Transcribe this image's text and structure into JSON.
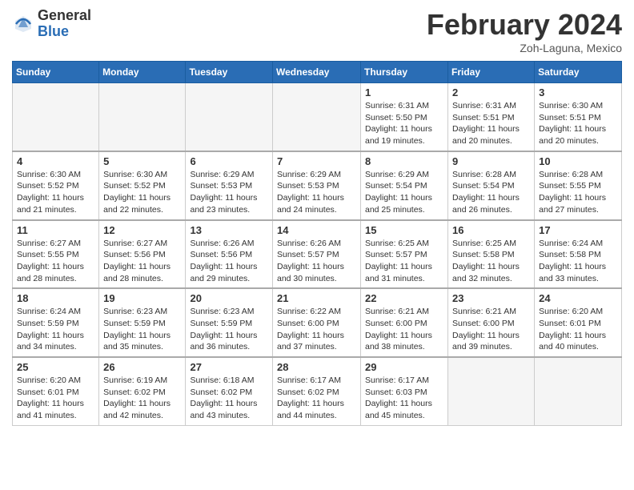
{
  "header": {
    "logo_general": "General",
    "logo_blue": "Blue",
    "month_title": "February 2024",
    "location": "Zoh-Laguna, Mexico"
  },
  "weekdays": [
    "Sunday",
    "Monday",
    "Tuesday",
    "Wednesday",
    "Thursday",
    "Friday",
    "Saturday"
  ],
  "weeks": [
    [
      {
        "day": "",
        "info": ""
      },
      {
        "day": "",
        "info": ""
      },
      {
        "day": "",
        "info": ""
      },
      {
        "day": "",
        "info": ""
      },
      {
        "day": "1",
        "info": "Sunrise: 6:31 AM\nSunset: 5:50 PM\nDaylight: 11 hours and 19 minutes."
      },
      {
        "day": "2",
        "info": "Sunrise: 6:31 AM\nSunset: 5:51 PM\nDaylight: 11 hours and 20 minutes."
      },
      {
        "day": "3",
        "info": "Sunrise: 6:30 AM\nSunset: 5:51 PM\nDaylight: 11 hours and 20 minutes."
      }
    ],
    [
      {
        "day": "4",
        "info": "Sunrise: 6:30 AM\nSunset: 5:52 PM\nDaylight: 11 hours and 21 minutes."
      },
      {
        "day": "5",
        "info": "Sunrise: 6:30 AM\nSunset: 5:52 PM\nDaylight: 11 hours and 22 minutes."
      },
      {
        "day": "6",
        "info": "Sunrise: 6:29 AM\nSunset: 5:53 PM\nDaylight: 11 hours and 23 minutes."
      },
      {
        "day": "7",
        "info": "Sunrise: 6:29 AM\nSunset: 5:53 PM\nDaylight: 11 hours and 24 minutes."
      },
      {
        "day": "8",
        "info": "Sunrise: 6:29 AM\nSunset: 5:54 PM\nDaylight: 11 hours and 25 minutes."
      },
      {
        "day": "9",
        "info": "Sunrise: 6:28 AM\nSunset: 5:54 PM\nDaylight: 11 hours and 26 minutes."
      },
      {
        "day": "10",
        "info": "Sunrise: 6:28 AM\nSunset: 5:55 PM\nDaylight: 11 hours and 27 minutes."
      }
    ],
    [
      {
        "day": "11",
        "info": "Sunrise: 6:27 AM\nSunset: 5:55 PM\nDaylight: 11 hours and 28 minutes."
      },
      {
        "day": "12",
        "info": "Sunrise: 6:27 AM\nSunset: 5:56 PM\nDaylight: 11 hours and 28 minutes."
      },
      {
        "day": "13",
        "info": "Sunrise: 6:26 AM\nSunset: 5:56 PM\nDaylight: 11 hours and 29 minutes."
      },
      {
        "day": "14",
        "info": "Sunrise: 6:26 AM\nSunset: 5:57 PM\nDaylight: 11 hours and 30 minutes."
      },
      {
        "day": "15",
        "info": "Sunrise: 6:25 AM\nSunset: 5:57 PM\nDaylight: 11 hours and 31 minutes."
      },
      {
        "day": "16",
        "info": "Sunrise: 6:25 AM\nSunset: 5:58 PM\nDaylight: 11 hours and 32 minutes."
      },
      {
        "day": "17",
        "info": "Sunrise: 6:24 AM\nSunset: 5:58 PM\nDaylight: 11 hours and 33 minutes."
      }
    ],
    [
      {
        "day": "18",
        "info": "Sunrise: 6:24 AM\nSunset: 5:59 PM\nDaylight: 11 hours and 34 minutes."
      },
      {
        "day": "19",
        "info": "Sunrise: 6:23 AM\nSunset: 5:59 PM\nDaylight: 11 hours and 35 minutes."
      },
      {
        "day": "20",
        "info": "Sunrise: 6:23 AM\nSunset: 5:59 PM\nDaylight: 11 hours and 36 minutes."
      },
      {
        "day": "21",
        "info": "Sunrise: 6:22 AM\nSunset: 6:00 PM\nDaylight: 11 hours and 37 minutes."
      },
      {
        "day": "22",
        "info": "Sunrise: 6:21 AM\nSunset: 6:00 PM\nDaylight: 11 hours and 38 minutes."
      },
      {
        "day": "23",
        "info": "Sunrise: 6:21 AM\nSunset: 6:00 PM\nDaylight: 11 hours and 39 minutes."
      },
      {
        "day": "24",
        "info": "Sunrise: 6:20 AM\nSunset: 6:01 PM\nDaylight: 11 hours and 40 minutes."
      }
    ],
    [
      {
        "day": "25",
        "info": "Sunrise: 6:20 AM\nSunset: 6:01 PM\nDaylight: 11 hours and 41 minutes."
      },
      {
        "day": "26",
        "info": "Sunrise: 6:19 AM\nSunset: 6:02 PM\nDaylight: 11 hours and 42 minutes."
      },
      {
        "day": "27",
        "info": "Sunrise: 6:18 AM\nSunset: 6:02 PM\nDaylight: 11 hours and 43 minutes."
      },
      {
        "day": "28",
        "info": "Sunrise: 6:17 AM\nSunset: 6:02 PM\nDaylight: 11 hours and 44 minutes."
      },
      {
        "day": "29",
        "info": "Sunrise: 6:17 AM\nSunset: 6:03 PM\nDaylight: 11 hours and 45 minutes."
      },
      {
        "day": "",
        "info": ""
      },
      {
        "day": "",
        "info": ""
      }
    ]
  ]
}
